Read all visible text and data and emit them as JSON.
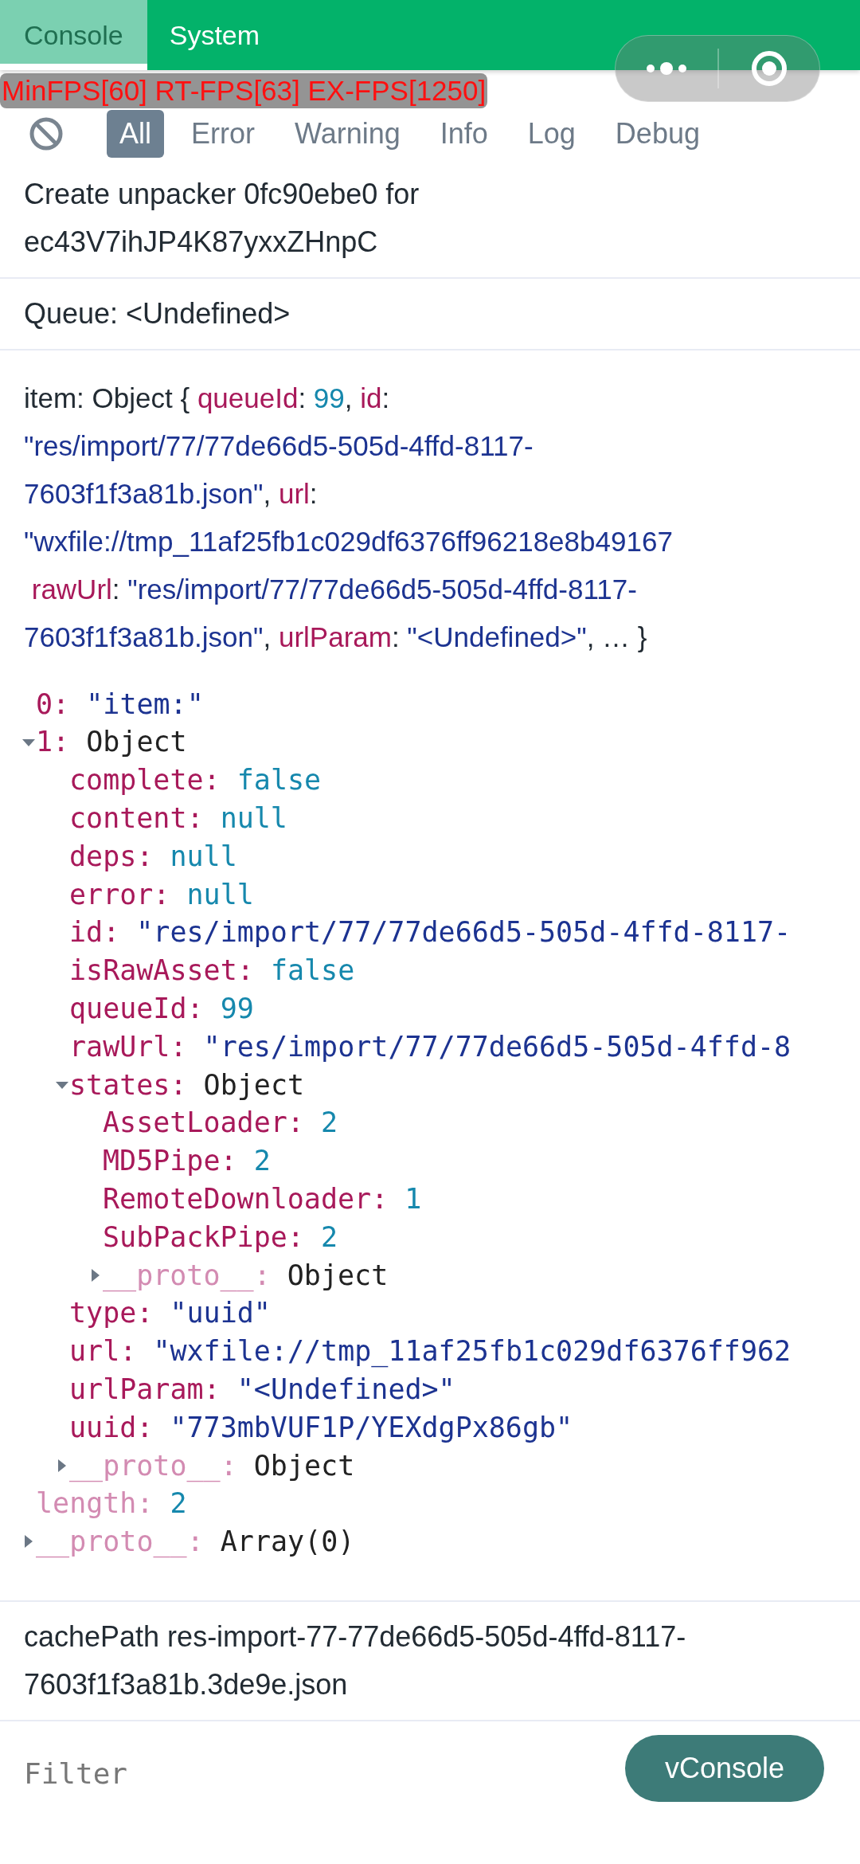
{
  "tabs": [
    {
      "label": "Console",
      "selected": true
    },
    {
      "label": "System",
      "selected": false
    }
  ],
  "filters": [
    {
      "label": "All",
      "selected": true
    },
    {
      "label": "Error",
      "selected": false
    },
    {
      "label": "Warning",
      "selected": false
    },
    {
      "label": "Info",
      "selected": false
    },
    {
      "label": "Log",
      "selected": false
    },
    {
      "label": "Debug",
      "selected": false
    }
  ],
  "fps_overlay": "MinFPS[60] RT-FPS[63] EX-FPS[1250]",
  "logs": [
    {
      "kind": "text",
      "lines": [
        "Create unpacker 0fc90ebe0 for",
        "ec43V7ihJP4K87yxxZHnpC"
      ]
    },
    {
      "kind": "text",
      "lines": [
        "Queue: <Undefined>"
      ]
    },
    {
      "kind": "object",
      "summary": [
        [
          {
            "kind": "plain",
            "text": "item: Object { "
          },
          {
            "kind": "key",
            "text": "queueId"
          },
          {
            "kind": "plain",
            "text": ": "
          },
          {
            "kind": "number",
            "text": "99"
          },
          {
            "kind": "plain",
            "text": ", "
          },
          {
            "kind": "key",
            "text": "id"
          },
          {
            "kind": "plain",
            "text": ":"
          }
        ],
        [
          {
            "kind": "string",
            "text": "\"res/import/77/77de66d5-505d-4ffd-8117-"
          }
        ],
        [
          {
            "kind": "string",
            "text": "7603f1f3a81b.json\""
          },
          {
            "kind": "plain",
            "text": ", "
          },
          {
            "kind": "key",
            "text": "url"
          },
          {
            "kind": "plain",
            "text": ":"
          }
        ],
        [
          {
            "kind": "string",
            "text": "\"wxfile://tmp_11af25fb1c029df6376ff96218e8b49167"
          }
        ],
        [
          {
            "kind": "key",
            "text": " rawUrl"
          },
          {
            "kind": "plain",
            "text": ": "
          },
          {
            "kind": "string",
            "text": "\"res/import/77/77de66d5-505d-4ffd-8117-"
          }
        ],
        [
          {
            "kind": "string",
            "text": "7603f1f3a81b.json\""
          },
          {
            "kind": "plain",
            "text": ", "
          },
          {
            "kind": "key",
            "text": "urlParam"
          },
          {
            "kind": "plain",
            "text": ": "
          },
          {
            "kind": "string",
            "text": "\"<Undefined>\""
          },
          {
            "kind": "plain",
            "text": ", … }"
          }
        ]
      ],
      "tree": [
        {
          "key": "0:",
          "inherited": false,
          "value": "\"item:\"",
          "kind": "string"
        },
        {
          "key": "1:",
          "inherited": false,
          "value": "Object",
          "kind": "object",
          "expanded": true,
          "children": [
            {
              "key": "complete:",
              "inherited": false,
              "value": "false",
              "kind": "boolean"
            },
            {
              "key": "content:",
              "inherited": false,
              "value": "null",
              "kind": "null"
            },
            {
              "key": "deps:",
              "inherited": false,
              "value": "null",
              "kind": "null"
            },
            {
              "key": "error:",
              "inherited": false,
              "value": "null",
              "kind": "null"
            },
            {
              "key": "id:",
              "inherited": false,
              "value": "\"res/import/77/77de66d5-505d-4ffd-8117-",
              "kind": "string"
            },
            {
              "key": "isRawAsset:",
              "inherited": false,
              "value": "false",
              "kind": "boolean"
            },
            {
              "key": "queueId:",
              "inherited": false,
              "value": "99",
              "kind": "number"
            },
            {
              "key": "rawUrl:",
              "inherited": false,
              "value": "\"res/import/77/77de66d5-505d-4ffd-8",
              "kind": "string"
            },
            {
              "key": "states:",
              "inherited": false,
              "value": "Object",
              "kind": "object",
              "expanded": true,
              "children": [
                {
                  "key": "AssetLoader:",
                  "inherited": false,
                  "value": "2",
                  "kind": "number"
                },
                {
                  "key": "MD5Pipe:",
                  "inherited": false,
                  "value": "2",
                  "kind": "number"
                },
                {
                  "key": "RemoteDownloader:",
                  "inherited": false,
                  "value": "1",
                  "kind": "number"
                },
                {
                  "key": "SubPackPipe:",
                  "inherited": false,
                  "value": "2",
                  "kind": "number"
                },
                {
                  "key": "__proto__:",
                  "inherited": true,
                  "value": "Object",
                  "kind": "object",
                  "expanded": false
                }
              ]
            },
            {
              "key": "type:",
              "inherited": false,
              "value": "\"uuid\"",
              "kind": "string"
            },
            {
              "key": "url:",
              "inherited": false,
              "value": "\"wxfile://tmp_11af25fb1c029df6376ff962",
              "kind": "string"
            },
            {
              "key": "urlParam:",
              "inherited": false,
              "value": "\"<Undefined>\"",
              "kind": "string"
            },
            {
              "key": "uuid:",
              "inherited": false,
              "value": "\"773mbVUF1P/YEXdgPx86gb\"",
              "kind": "string"
            },
            {
              "key": "__proto__:",
              "inherited": true,
              "value": "Object",
              "kind": "object",
              "expanded": false
            }
          ]
        },
        {
          "key": "length:",
          "inherited": true,
          "value": "2",
          "kind": "number"
        },
        {
          "key": "__proto__:",
          "inherited": true,
          "value": "Array(0)",
          "kind": "object",
          "expanded": false
        }
      ]
    },
    {
      "kind": "text",
      "lines": [
        "cachePath res-import-77-77de66d5-505d-4ffd-8117-",
        "7603f1f3a81b.3de9e.json"
      ]
    }
  ],
  "filter_field": {
    "placeholder": "Filter"
  },
  "toggle_button": "vConsole"
}
